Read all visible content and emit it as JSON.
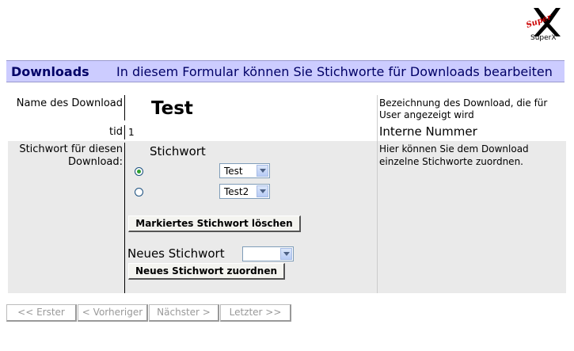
{
  "logo": {
    "text": "SuperX",
    "mark": "Super"
  },
  "header": {
    "title": "Downloads",
    "description": "In diesem Formular können Sie Stichworte für Downloads bearbeiten"
  },
  "form": {
    "name_label": "Name des Download",
    "name_value": "Test",
    "name_help": "Bezeichnung des Download, die für User angezeigt wird",
    "tid_label": "tid",
    "tid_value": "1",
    "tid_help": "Interne Nummer",
    "keyword_label": "Stichwort für diesen Download:",
    "keyword_heading": "Stichwort",
    "keywords": [
      {
        "value": "Test",
        "selected": true
      },
      {
        "value": "Test2",
        "selected": false
      }
    ],
    "delete_button": "Markiertes Stichwort löschen",
    "new_keyword_label": "Neues Stichwort",
    "new_keyword_value": "",
    "assign_button": "Neues Stichwort zuordnen",
    "keyword_help": "Hier können Sie dem Download einzelne Stichworte zuordnen."
  },
  "nav": {
    "first": "<< Erster",
    "prev": "< Vorheriger",
    "next": "Nächster >",
    "last": "Letzter >>"
  }
}
